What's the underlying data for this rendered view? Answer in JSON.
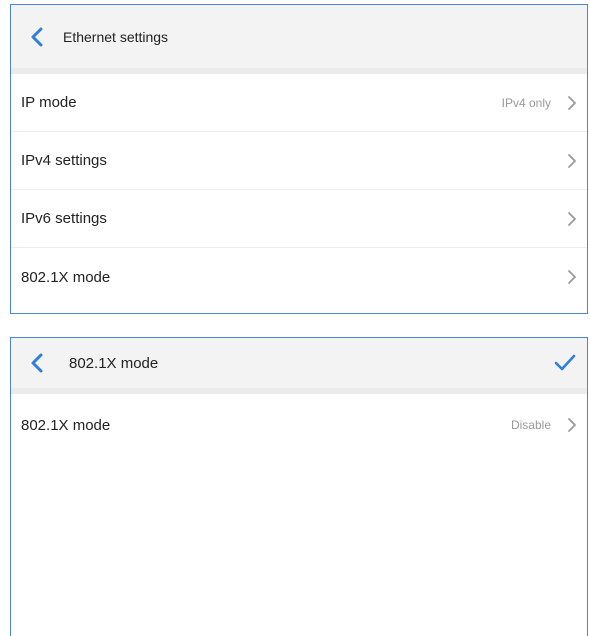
{
  "ethernet_panel": {
    "title": "Ethernet settings",
    "rows": [
      {
        "label": "IP mode",
        "value": "IPv4 only"
      },
      {
        "label": "IPv4 settings",
        "value": ""
      },
      {
        "label": "IPv6 settings",
        "value": ""
      },
      {
        "label": "802.1X mode",
        "value": ""
      }
    ]
  },
  "dot1x_panel": {
    "title": "802.1X mode",
    "rows": [
      {
        "label": "802.1X mode",
        "value": "Disable"
      }
    ]
  },
  "colors": {
    "accent": "#2f7fe0",
    "chevron": "#9a9a9a",
    "header_bg": "#f3f3f3",
    "panel_border": "#4a86d8"
  },
  "icons": {
    "back": "chevron-left-icon",
    "row": "chevron-right-icon",
    "confirm": "checkmark-icon"
  }
}
